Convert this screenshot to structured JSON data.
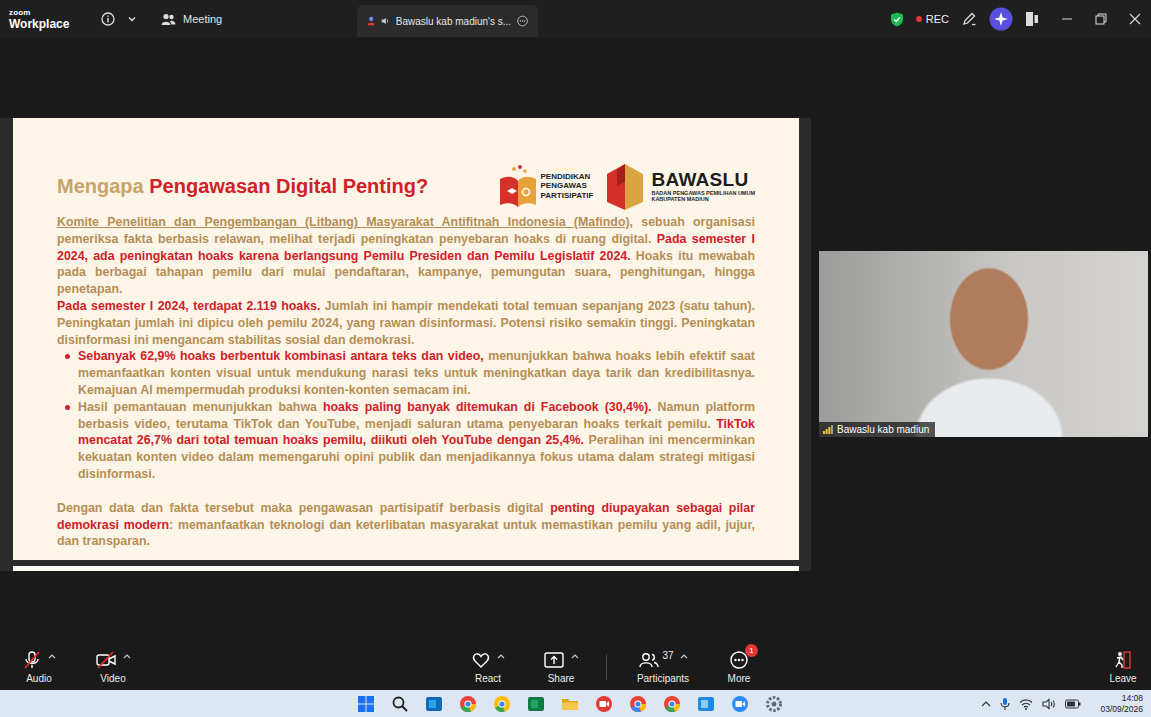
{
  "window": {
    "logo_top": "zoom",
    "logo_bottom": "Workplace"
  },
  "topbar": {
    "meeting_label": "Meeting",
    "tab_label": "Bawaslu kab madiun's s...",
    "rec_label": "REC",
    "recording": true
  },
  "slide": {
    "title_lead": "Mengapa ",
    "title_highlight": "Pengawasan Digital Penting?",
    "logo1_lines": [
      "PENDIDIKAN",
      "PENGAWAS",
      "PARTISIPATIF"
    ],
    "logo2_title": "BAWASLU",
    "logo2_sub": [
      "BADAN PENGAWAS PEMILIHAN UMUM",
      "KABUPATEN MADIUN"
    ],
    "paragraphs": [
      {
        "kind": "paragraph",
        "segments": [
          {
            "kind": "link",
            "text": "Komite Penelitian dan Pengembangan (Litbang) Masyarakat Antifitnah Indonesia (Mafindo),"
          },
          {
            "kind": "plain",
            "text": " sebuah organisasi pemeriksa fakta berbasis relawan, melihat terjadi peningkatan penyebaran hoaks di ruang digital. "
          },
          {
            "kind": "highlight",
            "text": "Pada semester I 2024, ada peningkatan hoaks karena berlangsung Pemilu Presiden dan Pemilu Legislatif 2024."
          },
          {
            "kind": "plain",
            "text": " Hoaks itu mewabah pada berbagai tahapan pemilu dari mulai pendaftaran, kampanye, pemungutan suara, penghitungan, hingga penetapan."
          }
        ]
      },
      {
        "kind": "paragraph",
        "segments": [
          {
            "kind": "highlight",
            "text": "Pada semester I 2024, terdapat 2.119 hoaks."
          },
          {
            "kind": "plain",
            "text": " Jumlah ini hampir mendekati total temuan sepanjang 2023 (satu tahun). Peningkatan jumlah ini dipicu oleh pemilu 2024, yang rawan disinformasi. Potensi risiko semakin tinggi. Peningkatan disinformasi ini mengancam stabilitas sosial dan demokrasi."
          }
        ]
      },
      {
        "kind": "bullet",
        "segments": [
          {
            "kind": "highlight",
            "text": "Sebanyak 62,9% hoaks berbentuk kombinasi antara teks dan video,"
          },
          {
            "kind": "plain",
            "text": " menunjukkan bahwa hoaks lebih efektif saat memanfaatkan konten visual untuk mendukung narasi teks untuk meningkatkan daya tarik dan kredibilitasnya. Kemajuan AI mempermudah produksi konten-konten semacam ini."
          }
        ]
      },
      {
        "kind": "bullet",
        "segments": [
          {
            "kind": "plain",
            "text": "Hasil pemantauan menunjukkan bahwa "
          },
          {
            "kind": "highlight",
            "text": "hoaks paling banyak ditemukan di Facebook (30,4%)."
          },
          {
            "kind": "plain",
            "text": " Namun platform berbasis video, terutama TikTok dan YouTube, menjadi saluran utama penyebaran hoaks terkait pemilu. "
          },
          {
            "kind": "highlight",
            "text": "TikTok mencatat 26,7% dari total temuan hoaks pemilu, diikuti oleh YouTube dengan 25,4%."
          },
          {
            "kind": "plain",
            "text": " Peralihan ini mencerminkan kekuatan konten video dalam memengaruhi opini publik dan menjadikannya fokus utama dalam strategi mitigasi disinformasi."
          }
        ]
      },
      {
        "kind": "closing",
        "segments": [
          {
            "kind": "plain",
            "text": "Dengan data dan fakta tersebut maka pengawasan partisipatif berbasis digital "
          },
          {
            "kind": "highlight",
            "text": "penting diupayakan sebagai pilar demokrasi modern"
          },
          {
            "kind": "plain",
            "text": ": memanfaatkan teknologi dan keterlibatan masyarakat untuk memastikan pemilu yang adil, jujur, dan transparan."
          }
        ]
      }
    ]
  },
  "video": {
    "name": "Bawaslu kab madiun"
  },
  "toolbar": {
    "audio": {
      "label": "Audio",
      "muted": true
    },
    "video": {
      "label": "Video",
      "muted": true
    },
    "react": {
      "label": "React"
    },
    "share": {
      "label": "Share"
    },
    "participants": {
      "label": "Participants",
      "count": "37"
    },
    "more": {
      "label": "More",
      "badge": "1"
    },
    "leave": {
      "label": "Leave"
    }
  },
  "taskbar": {
    "time": "14:08",
    "date": "03/09/2026"
  }
}
